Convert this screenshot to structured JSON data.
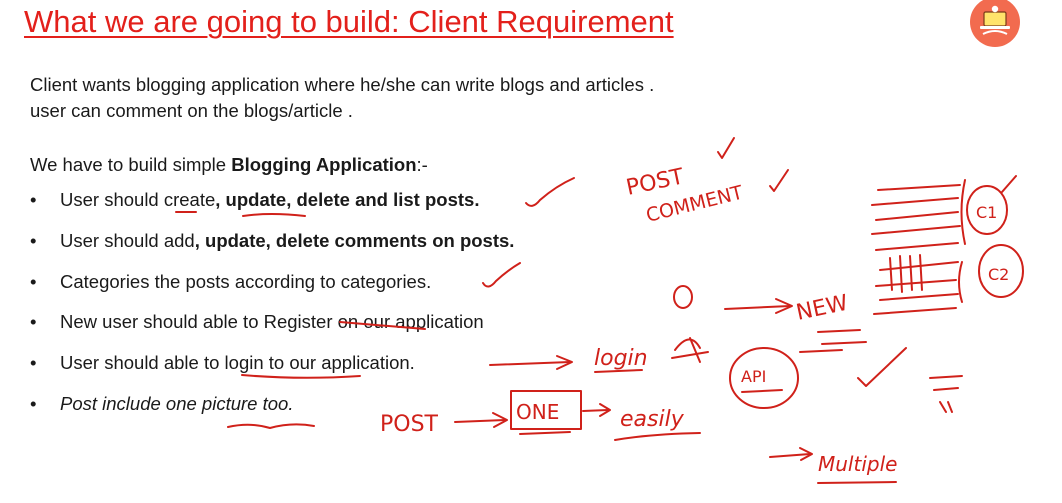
{
  "slide": {
    "title": "What we are going to build: Client Requirement",
    "intro_lines": [
      "Client wants  blogging application where he/she can write blogs and articles .",
      "user can comment on the blogs/article ."
    ],
    "lead_prefix": "We have to build simple ",
    "lead_bold": "Blogging Application",
    "lead_suffix": ":-",
    "requirements": [
      {
        "normal": "User should create",
        "bold": ", update, delete and list posts.",
        "tail": ""
      },
      {
        "normal": "User should add",
        "bold": ", update, delete comments on posts.",
        "tail": ""
      },
      {
        "normal": "Categories the posts according to categories.",
        "bold": "",
        "tail": ""
      },
      {
        "normal": "New user should able to Register on our  application",
        "bold": "",
        "tail": ""
      },
      {
        "normal": "User should able to login to our application.",
        "bold": "",
        "tail": ""
      },
      {
        "normal": "Post include one picture too.",
        "bold": "",
        "tail": ""
      }
    ],
    "bullet": "•"
  },
  "annotations": {
    "post": "POST",
    "comment": "COMMENT",
    "new": "NEW",
    "login": "login",
    "api": "API",
    "post2": "POST",
    "one": "ONE",
    "easily": "easily",
    "multiple": "Multiple",
    "circle1": "C1",
    "circle2": "C2"
  },
  "colors": {
    "title": "#e3201b",
    "ink": "#d0211a",
    "text": "#1a1a1a",
    "logo_bg": "#f26b4f"
  },
  "icons": {
    "logo": "person-with-laptop-icon"
  }
}
